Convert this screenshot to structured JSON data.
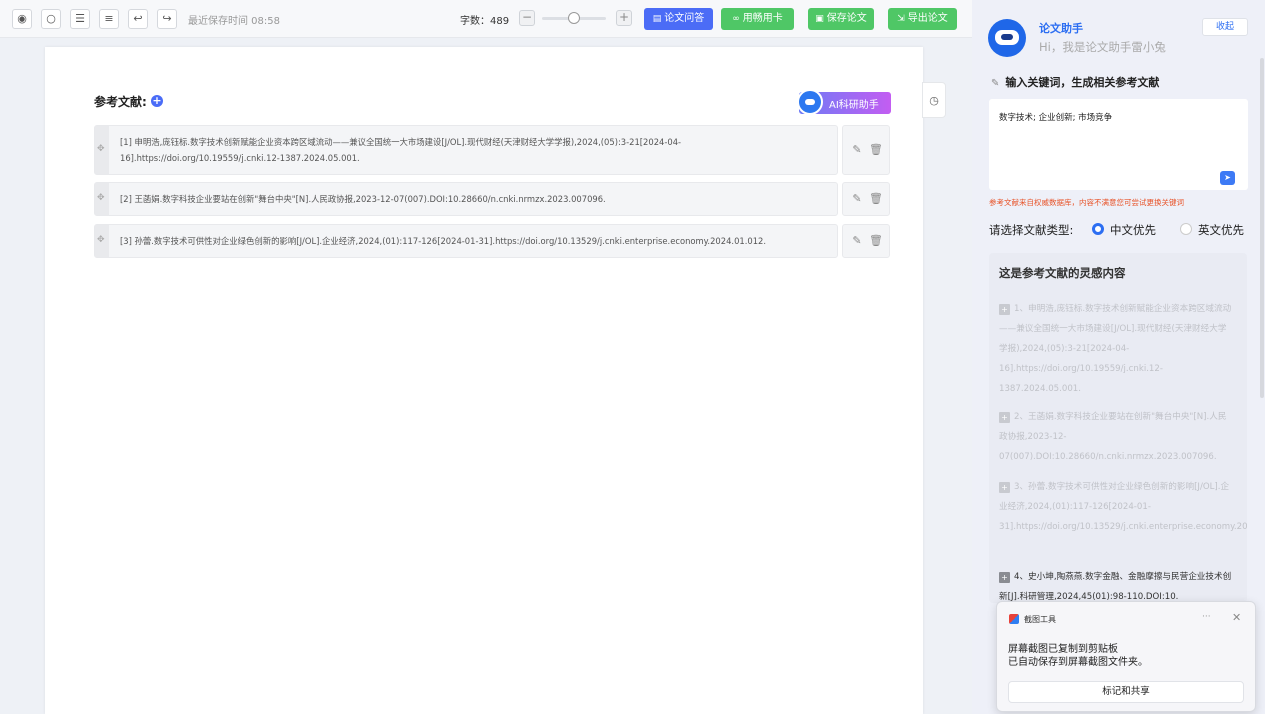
{
  "toolbar": {
    "icons": {
      "preview": "eye-icon",
      "search": "search-icon",
      "layout": "layout-icon",
      "outline": "outline-icon",
      "undo": "undo-icon",
      "redo": "redo-icon"
    },
    "last_saved": "最近保存时间 08:58",
    "word_count": "字数：489",
    "zoom_minus": "−",
    "zoom_plus": "+",
    "zoom_level": 0.5,
    "buttons": {
      "qa": "论文问答",
      "cards": "用畅用卡",
      "save": "保存论文",
      "export": "导出论文"
    },
    "colors": {
      "qa": "#4b6cf6",
      "cards": "#4fc766",
      "save": "#4fc766",
      "export": "#4fc766"
    }
  },
  "document": {
    "ref_title": "参考文献:",
    "ai_assistant": "AI科研助手",
    "references": [
      "[1] 申明浩,庞钰标.数字技术创新赋能企业资本跨区域流动——兼议全国统一大市场建设[J/OL].现代财经(天津财经大学学报),2024,(05):3-21[2024-04-16].https://doi.org/10.19559/j.cnki.12-1387.2024.05.001.",
      "[2] 王菡娟.数字科技企业要站在创新\"舞台中央\"[N].人民政协报,2023-12-07(007).DOI:10.28660/n.cnki.nrmzx.2023.007096.",
      "[3] 孙蕾.数字技术可供性对企业绿色创新的影响[J/OL].企业经济,2024,(01):117-126[2024-01-31].https://doi.org/10.13529/j.cnki.enterprise.economy.2024.01.012."
    ]
  },
  "assistant": {
    "name": "论文助手",
    "greeting": "Hi，我是论文助手雷小兔",
    "collapse": "收起",
    "keyword_prompt": "输入关键词，生成相关参考文献",
    "keywords": "数字技术; 企业创新; 市场竞争",
    "tip": "参考文献来自权威数据库，内容不满意您可尝试更换关键词",
    "type_label": "请选择文献类型:",
    "type_options": [
      "中文优先",
      "英文优先"
    ],
    "type_selected": "中文优先",
    "inspiration_title": "这是参考文献的灵感内容",
    "inspirations": [
      "1、申明浩,庞钰标.数字技术创新赋能企业资本跨区域流动——兼议全国统一大市场建设[J/OL].现代财经(天津财经大学学报),2024,(05):3-21[2024-04-16].https://doi.org/10.19559/j.cnki.12-1387.2024.05.001.",
      "2、王菡娟.数字科技企业要站在创新\"舞台中央\"[N].人民政协报,2023-12-07(007).DOI:10.28660/n.cnki.nrmzx.2023.007096.",
      "3、孙蕾.数字技术可供性对企业绿色创新的影响[J/OL].企业经济,2024,(01):117-126[2024-01-31].https://doi.org/10.13529/j.cnki.enterprise.economy.2024.01.012.",
      "4、史小坤,陶燕燕.数字金融、金融摩擦与民营企业技术创新[J].科研管理,2024,45(01):98-110.DOI:10."
    ]
  },
  "toast": {
    "app": "截图工具",
    "more": "···",
    "close": "✕",
    "title": "屏幕截图已复制到剪贴板",
    "body": "已自动保存到屏幕截图文件夹。",
    "action": "标记和共享"
  }
}
